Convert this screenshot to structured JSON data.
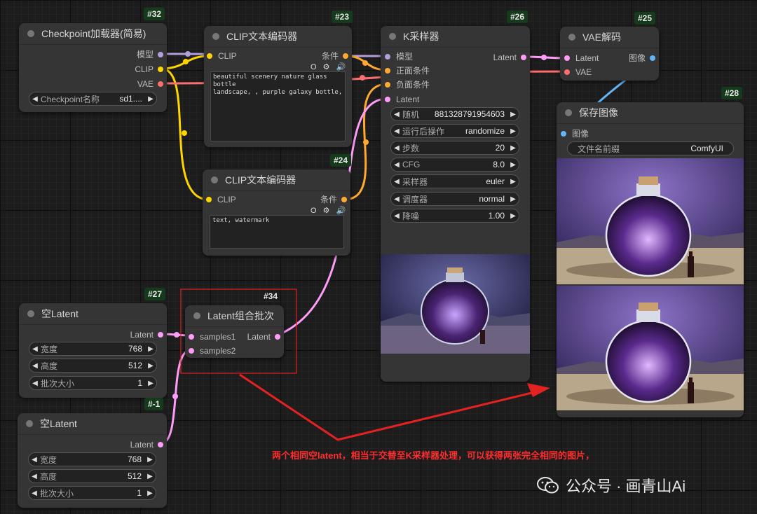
{
  "colors": {
    "model": "#b39ddb",
    "clip": "#ffd500",
    "vae": "#ff6e6e",
    "conditioning": "#ffa931",
    "latent": "#ff9cf9",
    "image": "#64b5f6"
  },
  "nodes": {
    "checkpoint": {
      "id": "#32",
      "title": "Checkpoint加载器(简易)",
      "out_model": "模型",
      "out_clip": "CLIP",
      "out_vae": "VAE",
      "ckpt_label": "Checkpoint名称",
      "ckpt_value": "sd1...."
    },
    "clip_pos": {
      "id": "#23",
      "title": "CLIP文本编码器",
      "in_clip": "CLIP",
      "out_cond": "条件",
      "text": "beautiful scenery nature glass bottle\nlandscape, , purple galaxy bottle,",
      "tools": "O ⚙ 🔊"
    },
    "clip_neg": {
      "id": "#24",
      "title": "CLIP文本编码器",
      "in_clip": "CLIP",
      "out_cond": "条件",
      "text": "text, watermark",
      "tools": "O ⚙ 🔊"
    },
    "ksampler": {
      "id": "#26",
      "title": "K采样器",
      "in_model": "模型",
      "in_pos": "正面条件",
      "in_neg": "负面条件",
      "in_latent": "Latent",
      "out_latent": "Latent",
      "widgets": [
        {
          "label": "随机",
          "value": "881328791954603"
        },
        {
          "label": "运行后操作",
          "value": "randomize"
        },
        {
          "label": "步数",
          "value": "20"
        },
        {
          "label": "CFG",
          "value": "8.0"
        },
        {
          "label": "采样器",
          "value": "euler"
        },
        {
          "label": "调度器",
          "value": "normal"
        },
        {
          "label": "降噪",
          "value": "1.00"
        }
      ]
    },
    "vae_decode": {
      "id": "#25",
      "title": "VAE解码",
      "in_latent": "Latent",
      "in_vae": "VAE",
      "out_image": "图像"
    },
    "save_image": {
      "id": "#28",
      "title": "保存图像",
      "in_image": "图像",
      "prefix_label": "文件名前缀",
      "prefix_value": "ComfyUI"
    },
    "latent27": {
      "id": "#27",
      "title": "空Latent",
      "out_latent": "Latent",
      "widgets": [
        {
          "label": "宽度",
          "value": "768"
        },
        {
          "label": "高度",
          "value": "512"
        },
        {
          "label": "批次大小",
          "value": "1"
        }
      ]
    },
    "latent_neg1": {
      "id": "#-1",
      "title": "空Latent",
      "out_latent": "Latent",
      "widgets": [
        {
          "label": "宽度",
          "value": "768"
        },
        {
          "label": "高度",
          "value": "512"
        },
        {
          "label": "批次大小",
          "value": "1"
        }
      ]
    },
    "batch": {
      "id": "#34",
      "title": "Latent组合批次",
      "in_s1": "samples1",
      "in_s2": "samples2",
      "out_latent": "Latent"
    }
  },
  "annotation": "两个相同空latent，相当于交替至K采样器处理，可以获得两张完全相同的图片，",
  "watermark": "公众号 · 画青山Ai"
}
